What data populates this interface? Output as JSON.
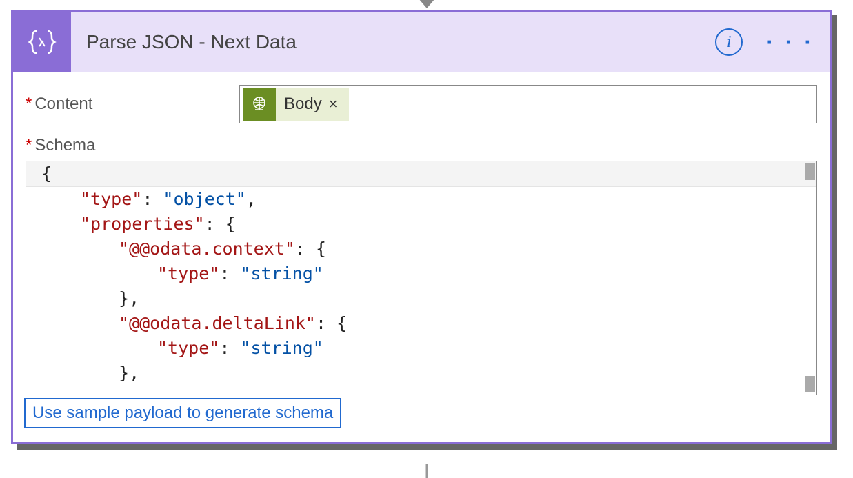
{
  "connector": {
    "arrow_in": true,
    "line_out": true
  },
  "header": {
    "title": "Parse JSON - Next Data",
    "info_icon": "i",
    "more_icon": "· · ·",
    "action_icon_name": "json-braces-icon"
  },
  "fields": {
    "content": {
      "label": "Content",
      "required": true,
      "token": {
        "label": "Body",
        "close": "×",
        "icon_name": "globe-icon"
      }
    },
    "schema": {
      "label": "Schema",
      "required": true,
      "generate_link_label": "Use sample payload to generate schema",
      "code_lines": [
        {
          "indent": 0,
          "raw": "{"
        },
        {
          "indent": 1,
          "key": "\"type\"",
          "sep": ": ",
          "val": "\"object\"",
          "tail": ","
        },
        {
          "indent": 1,
          "key": "\"properties\"",
          "sep": ": ",
          "brace": "{"
        },
        {
          "indent": 2,
          "key": "\"@@odata.context\"",
          "sep": ": ",
          "brace": "{"
        },
        {
          "indent": 3,
          "key": "\"type\"",
          "sep": ": ",
          "val": "\"string\""
        },
        {
          "indent": 2,
          "brace_close": "}",
          "tail": ","
        },
        {
          "indent": 2,
          "key": "\"@@odata.deltaLink\"",
          "sep": ": ",
          "brace": "{"
        },
        {
          "indent": 3,
          "key": "\"type\"",
          "sep": ": ",
          "val": "\"string\""
        },
        {
          "indent": 2,
          "brace_close": "}",
          "tail": ","
        }
      ]
    }
  }
}
